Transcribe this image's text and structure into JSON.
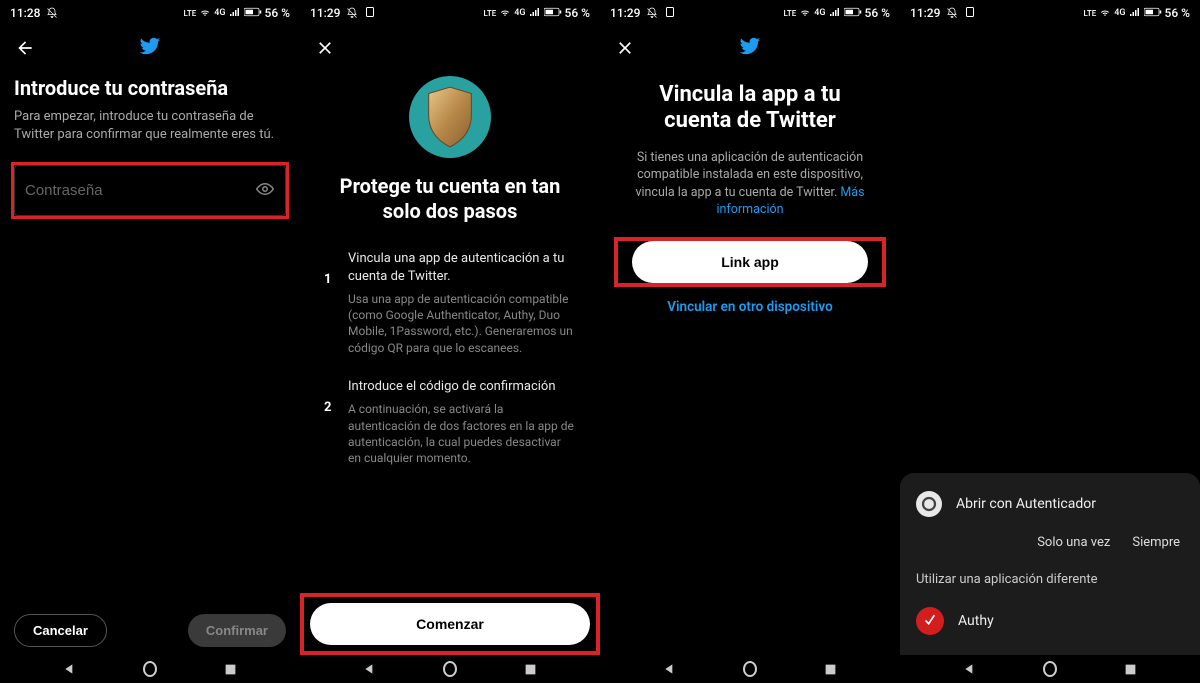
{
  "status": {
    "time1": "11:28",
    "time2": "11:29",
    "time3": "11:29",
    "time4": "11:29",
    "network": "4G",
    "lte": "LTE",
    "battery": "56 %"
  },
  "screen1": {
    "title": "Introduce tu contraseña",
    "subtitle": "Para empezar, introduce tu contraseña de Twitter para confirmar que realmente eres tú.",
    "password_placeholder": "Contraseña",
    "cancel": "Cancelar",
    "confirm": "Confirmar"
  },
  "screen2": {
    "title": "Protege tu cuenta en tan solo dos pasos",
    "step1_num": "1",
    "step1_title": "Vincula una app de autenticación a tu cuenta de Twitter.",
    "step1_desc": "Usa una app de autenticación compatible (como Google Authenticator, Authy, Duo Mobile, 1Password, etc.). Generaremos un código QR para que lo escanees.",
    "step2_num": "2",
    "step2_title": "Introduce el código de confirmación",
    "step2_desc": "A continuación, se activará la autenticación de dos factores en la app de autenticación, la cual puedes desactivar en cualquier momento.",
    "start": "Comenzar"
  },
  "screen3": {
    "title": "Vincula la app a tu cuenta de Twitter",
    "subtitle_pre": "Si tienes una aplicación de autenticación compatible instalada en este dispositivo, vincula la app a tu cuenta de Twitter. ",
    "subtitle_link": "Más información",
    "link_app": "Link app",
    "other_device": "Vincular en otro dispositivo"
  },
  "screen4": {
    "sheet_title": "Abrir con Autenticador",
    "once": "Solo una vez",
    "always": "Siempre",
    "diff_app": "Utilizar una aplicación diferente",
    "authy": "Authy"
  }
}
